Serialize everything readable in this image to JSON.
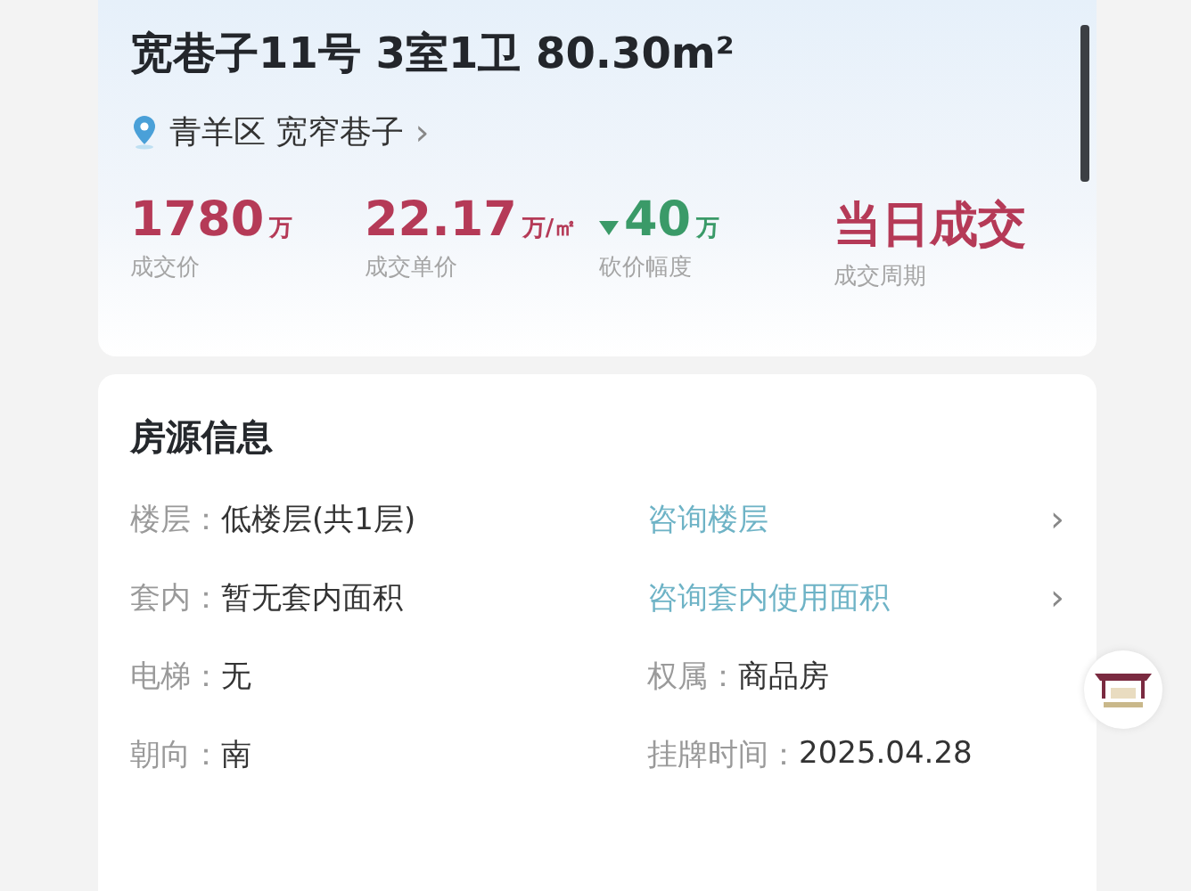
{
  "header": {
    "title": "宽巷子11号 3室1卫 80.30m²",
    "location": "青羊区 宽窄巷子",
    "location_arrow": "›"
  },
  "stats": [
    {
      "kind": "up",
      "value": "1780",
      "unit": "万",
      "label": "成交价"
    },
    {
      "kind": "up",
      "value": "22.17",
      "unit": "万/㎡",
      "label": "成交单价"
    },
    {
      "kind": "down",
      "value": "40",
      "unit": "万",
      "label": "砍价幅度"
    },
    {
      "kind": "up",
      "value": "当日成交",
      "label": "成交周期"
    }
  ],
  "info": {
    "title": "房源信息",
    "rows": [
      {
        "label": "楼层：",
        "value": "低楼层(共1层)",
        "right": {
          "kind": "link",
          "text": "咨询楼层",
          "arrow": "›"
        }
      },
      {
        "label": "套内：",
        "value": "暂无套内面积",
        "right": {
          "kind": "link",
          "text": "咨询套内使用面积",
          "arrow": "›"
        }
      },
      {
        "label": "电梯：",
        "value": "无",
        "right": {
          "kind": "field",
          "label": "权属：",
          "value": "商品房"
        }
      },
      {
        "label": "朝向：",
        "value": "南",
        "right": {
          "kind": "field",
          "label": "挂牌时间：",
          "value": "2025.04.28"
        }
      }
    ]
  }
}
